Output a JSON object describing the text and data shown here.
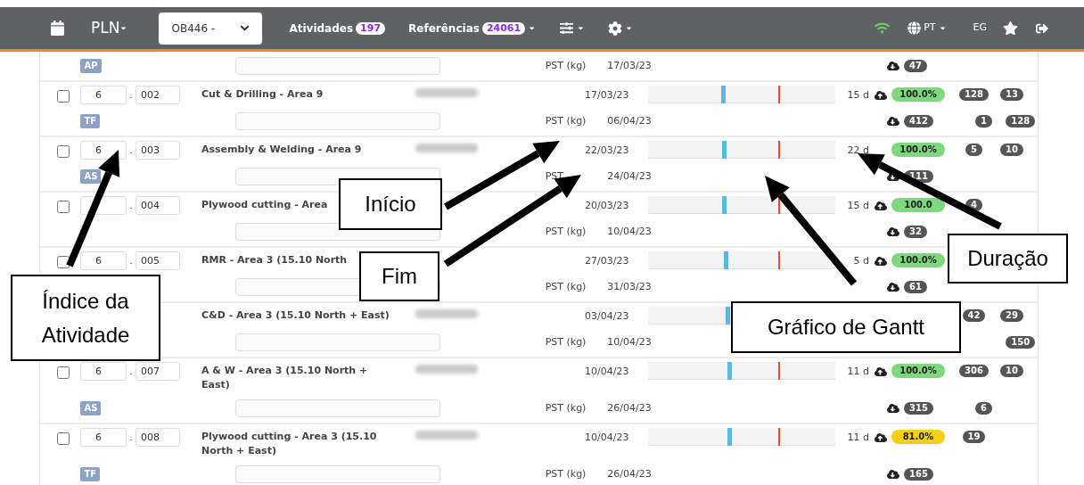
{
  "navbar": {
    "app": "PLN",
    "project_select": "OB446 -",
    "activities": {
      "label": "Atividades",
      "count": "197"
    },
    "references": {
      "label": "Referências",
      "count": "24061"
    },
    "language": "PT",
    "user": "EG"
  },
  "rows": [
    {
      "tag": "AP",
      "unit": "PST (kg)",
      "end": "17/03/23",
      "count": "47"
    },
    {
      "checked": false,
      "major": "6",
      "separator": ".",
      "minor": "002",
      "title": [
        "Cut & Drilling - Area 9"
      ],
      "owner_blurred": true,
      "start": "17/03/23",
      "duration": "15 d",
      "upload_icon": true,
      "progress": {
        "text": "100.0%",
        "color": "#7ed87e"
      },
      "top_a": "128",
      "top_b": "13",
      "tag": "TF",
      "unit": "PST (kg)",
      "end": "06/04/23",
      "count": "412",
      "bottom_a": "1",
      "bottom_b": "128"
    },
    {
      "checked": false,
      "major": "6",
      "separator": ".",
      "minor": "003",
      "title": [
        "Assembly & Welding - Area 9"
      ],
      "owner_blurred": true,
      "start": "22/03/23",
      "duration": "22 d",
      "upload_icon": false,
      "progress": {
        "text": "100.0%",
        "color": "#7ed87e"
      },
      "top_a": "5",
      "top_b": "10",
      "tag": "AS",
      "unit": "PST",
      "end": "24/04/23",
      "count": "111"
    },
    {
      "checked": false,
      "separator": ".",
      "minor": "004",
      "title": [
        "Plywood cutting - Area"
      ],
      "owner_blurred": false,
      "start": "20/03/23",
      "duration": "15 d",
      "upload_icon": true,
      "progress": {
        "text": "100.0",
        "color": "#7ed87e"
      },
      "top_a": "4",
      "unit": "PST (kg)",
      "end": "10/04/23",
      "count": "32"
    },
    {
      "checked": false,
      "major": "6",
      "separator": ".",
      "minor": "005",
      "title": [
        "RMR - Area 3 (15.10 North"
      ],
      "owner_blurred": false,
      "start": "27/03/23",
      "duration": "5 d",
      "upload_icon": true,
      "progress": {
        "text": "100.0%",
        "color": "#7ed87e"
      },
      "unit": "PST (kg)",
      "end": "31/03/23",
      "count": "61"
    },
    {
      "title": [
        "C&D - Area 3 (15.10 North + East)"
      ],
      "owner_blurred": true,
      "start": "03/04/23",
      "top_a": "42",
      "top_b": "29",
      "unit": "PST (kg)",
      "end": "10/04/23",
      "bottom_b": "150"
    },
    {
      "checked": false,
      "major": "6",
      "separator": ".",
      "minor": "007",
      "title": [
        "A & W - Area 3 (15.10 North +",
        "East)"
      ],
      "owner_blurred": true,
      "start": "10/04/23",
      "duration": "11 d",
      "upload_icon": true,
      "progress": {
        "text": "100.0%",
        "color": "#7ed87e"
      },
      "top_a": "306",
      "top_b": "10",
      "tag": "AS",
      "unit": "PST (kg)",
      "end": "26/04/23",
      "count": "315",
      "bottom_a": "6"
    },
    {
      "checked": false,
      "major": "6",
      "separator": ".",
      "minor": "008",
      "title": [
        "Plywood cutting - Area 3 (15.10",
        "North + East)"
      ],
      "owner_blurred": true,
      "start": "10/04/23",
      "duration": "11 d",
      "upload_icon": true,
      "progress": {
        "text": "81.0%",
        "color": "#f5cf14"
      },
      "top_a": "19",
      "tag": "TF",
      "unit": "PST (kg)",
      "end": "26/04/23",
      "count": "165"
    }
  ],
  "annotations": [
    {
      "text": "Início"
    },
    {
      "text": "Duração"
    },
    {
      "text": "Fim"
    },
    {
      "text": "Índice da Atividade"
    },
    {
      "text": "Gráfico de Gantt"
    }
  ]
}
